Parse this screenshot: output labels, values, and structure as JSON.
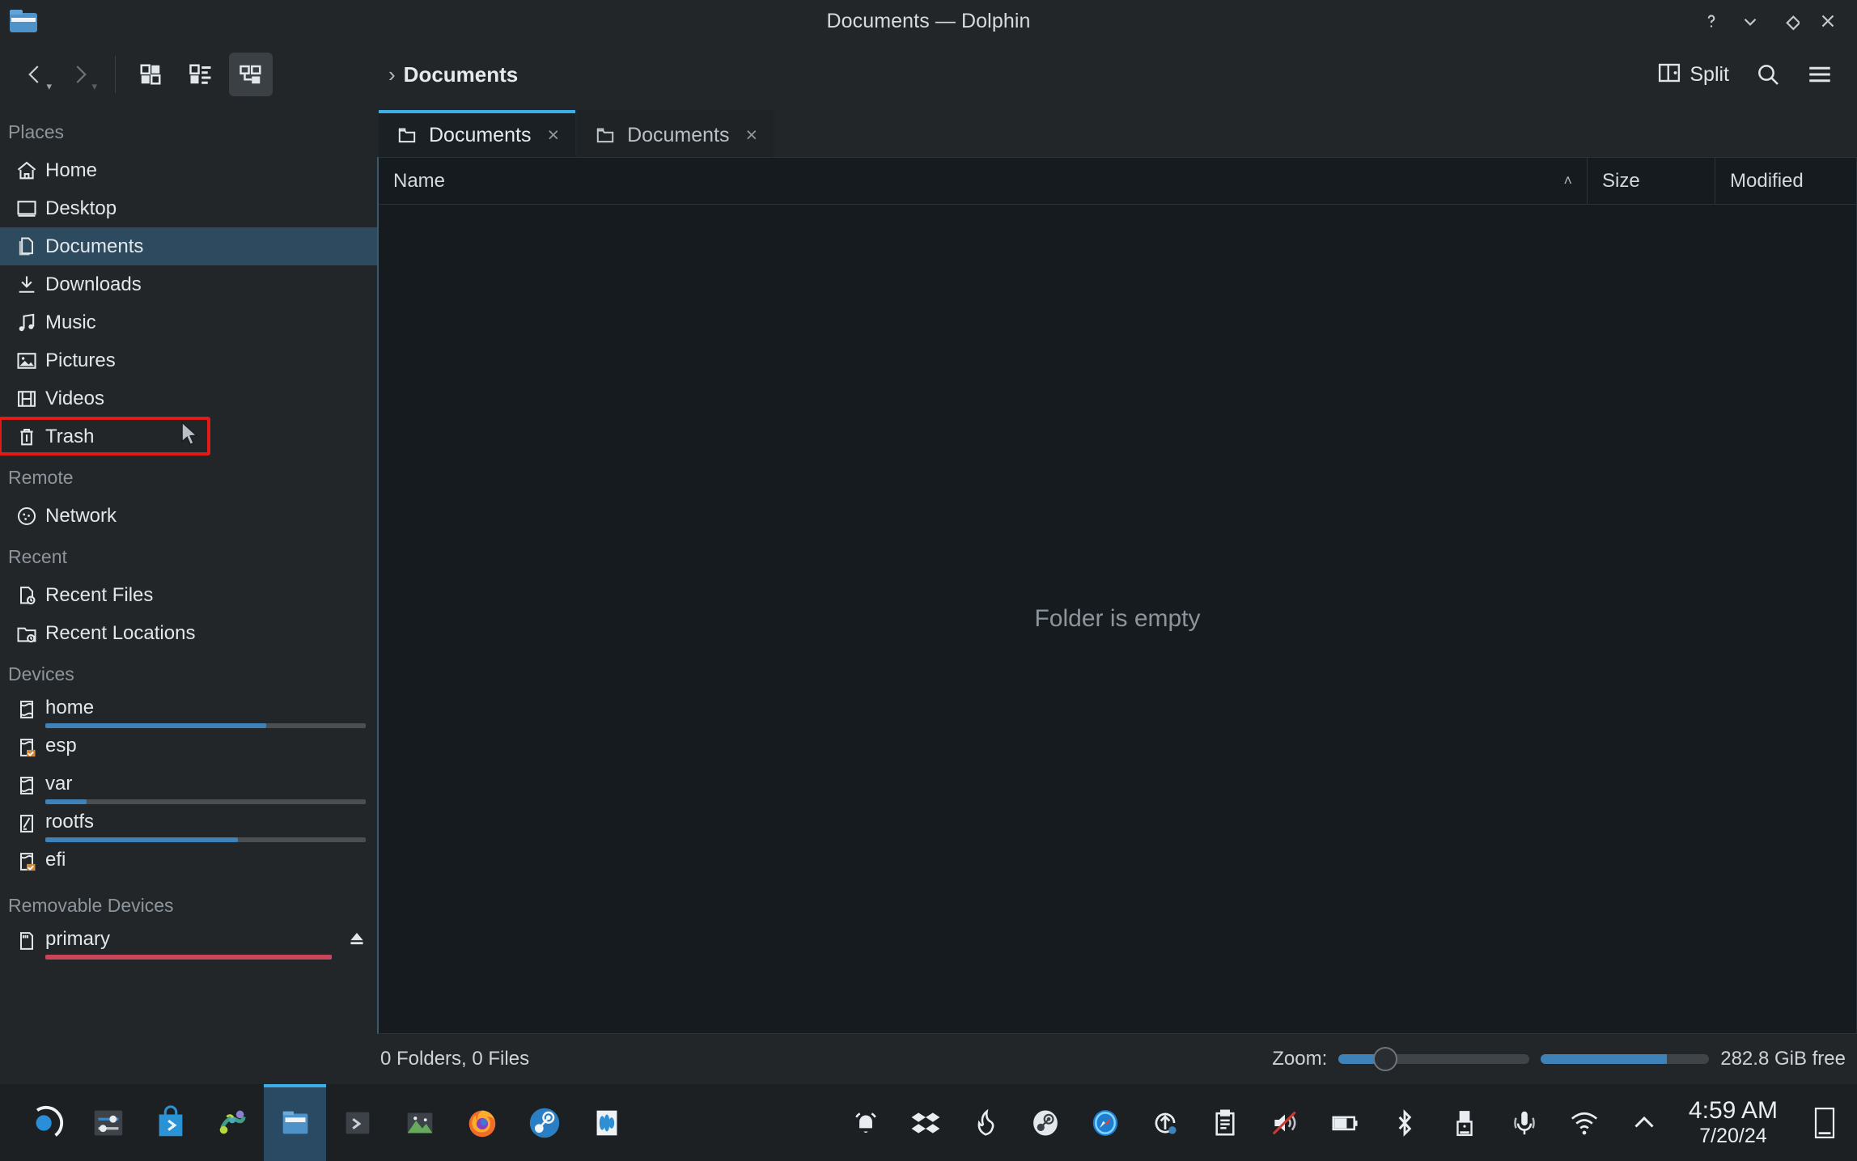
{
  "window": {
    "title": "Documents — Dolphin",
    "app_icon": "folder-icon",
    "controls": [
      {
        "name": "help-button",
        "glyph": "?"
      },
      {
        "name": "minimize-button",
        "glyph": "v"
      },
      {
        "name": "maximize-button",
        "glyph": "diamond"
      },
      {
        "name": "close-button",
        "glyph": "x"
      }
    ]
  },
  "toolbar": {
    "back_label": "Back",
    "forward_label": "Forward",
    "view_icons_label": "Icons",
    "view_compact_label": "Compact",
    "view_details_label": "Details",
    "split_label": "Split",
    "search_label": "Search",
    "menu_label": "Menu"
  },
  "breadcrumb": {
    "chevron": "›",
    "current": "Documents"
  },
  "tabs": [
    {
      "label": "Documents",
      "icon": "folder-icon",
      "close": "×",
      "active": true
    },
    {
      "label": "Documents",
      "icon": "folder-icon",
      "close": "×",
      "active": false
    }
  ],
  "sidebar": {
    "sections": [
      {
        "title": "Places",
        "items": [
          {
            "label": "Home",
            "icon": "home-icon",
            "selected": false
          },
          {
            "label": "Desktop",
            "icon": "desktop-icon",
            "selected": false
          },
          {
            "label": "Documents",
            "icon": "documents-icon",
            "selected": true
          },
          {
            "label": "Downloads",
            "icon": "download-icon",
            "selected": false
          },
          {
            "label": "Music",
            "icon": "music-icon",
            "selected": false
          },
          {
            "label": "Pictures",
            "icon": "picture-icon",
            "selected": false
          },
          {
            "label": "Videos",
            "icon": "video-icon",
            "selected": false
          },
          {
            "label": "Trash",
            "icon": "trash-icon",
            "selected": false,
            "highlighted": true
          }
        ]
      },
      {
        "title": "Remote",
        "items": [
          {
            "label": "Network",
            "icon": "network-icon",
            "selected": false
          }
        ]
      },
      {
        "title": "Recent",
        "items": [
          {
            "label": "Recent Files",
            "icon": "recent-file-icon",
            "selected": false
          },
          {
            "label": "Recent Locations",
            "icon": "recent-folder-icon",
            "selected": false
          }
        ]
      },
      {
        "title": "Devices",
        "items": [
          {
            "label": "home",
            "icon": "drive-icon",
            "capacity_pct": 69
          },
          {
            "label": "esp",
            "icon": "drive-unmounted-icon"
          },
          {
            "label": "var",
            "icon": "drive-icon",
            "capacity_pct": 13
          },
          {
            "label": "rootfs",
            "icon": "drive-root-icon",
            "capacity_pct": 60
          },
          {
            "label": "efi",
            "icon": "drive-unmounted-icon"
          }
        ]
      },
      {
        "title": "Removable Devices",
        "items": [
          {
            "label": "primary",
            "icon": "sdcard-icon",
            "capacity_pct": 100,
            "capacity_full": true,
            "eject": true
          }
        ]
      }
    ]
  },
  "columns": [
    {
      "label": "Name",
      "sort": "˄"
    },
    {
      "label": "Size"
    },
    {
      "label": "Modified"
    }
  ],
  "content": {
    "empty_message": "Folder is empty"
  },
  "status": {
    "count": "0 Folders, 0 Files",
    "zoom_label": "Zoom:",
    "zoom_value": 18,
    "free_space_pct": 75,
    "free_space": "282.8 GiB free"
  },
  "taskbar": {
    "launchers": [
      {
        "name": "kde-menu-icon"
      },
      {
        "name": "settings-icon"
      },
      {
        "name": "discover-store-icon"
      },
      {
        "name": "kdenlive-icon"
      },
      {
        "name": "dolphin-file-manager-icon",
        "active": true
      },
      {
        "name": "terminal-icon"
      },
      {
        "name": "image-viewer-icon"
      },
      {
        "name": "firefox-icon"
      },
      {
        "name": "steam-icon"
      },
      {
        "name": "audio-mixer-icon"
      }
    ],
    "tray": [
      {
        "name": "notifications-bell-icon"
      },
      {
        "name": "dropbox-icon"
      },
      {
        "name": "flame-icon"
      },
      {
        "name": "steam-tray-icon"
      },
      {
        "name": "portal-compass-icon"
      },
      {
        "name": "update-icon"
      },
      {
        "name": "clipboard-icon"
      },
      {
        "name": "volume-muted-icon"
      },
      {
        "name": "battery-icon"
      },
      {
        "name": "bluetooth-icon"
      },
      {
        "name": "usb-device-icon"
      },
      {
        "name": "microphone-icon"
      },
      {
        "name": "wifi-icon"
      },
      {
        "name": "show-hidden-tray-icon"
      }
    ],
    "clock": {
      "time": "4:59 AM",
      "date": "7/20/24"
    },
    "show_desktop": "show-desktop-icon"
  },
  "colors": {
    "accent": "#3daee9",
    "selection": "#2d4a5e",
    "highlight_box": "#e01b18",
    "capacity_blue": "#3e82b8",
    "capacity_red": "#c9455a",
    "sidebar_bg": "#232629",
    "view_bg": "#161b1f"
  }
}
